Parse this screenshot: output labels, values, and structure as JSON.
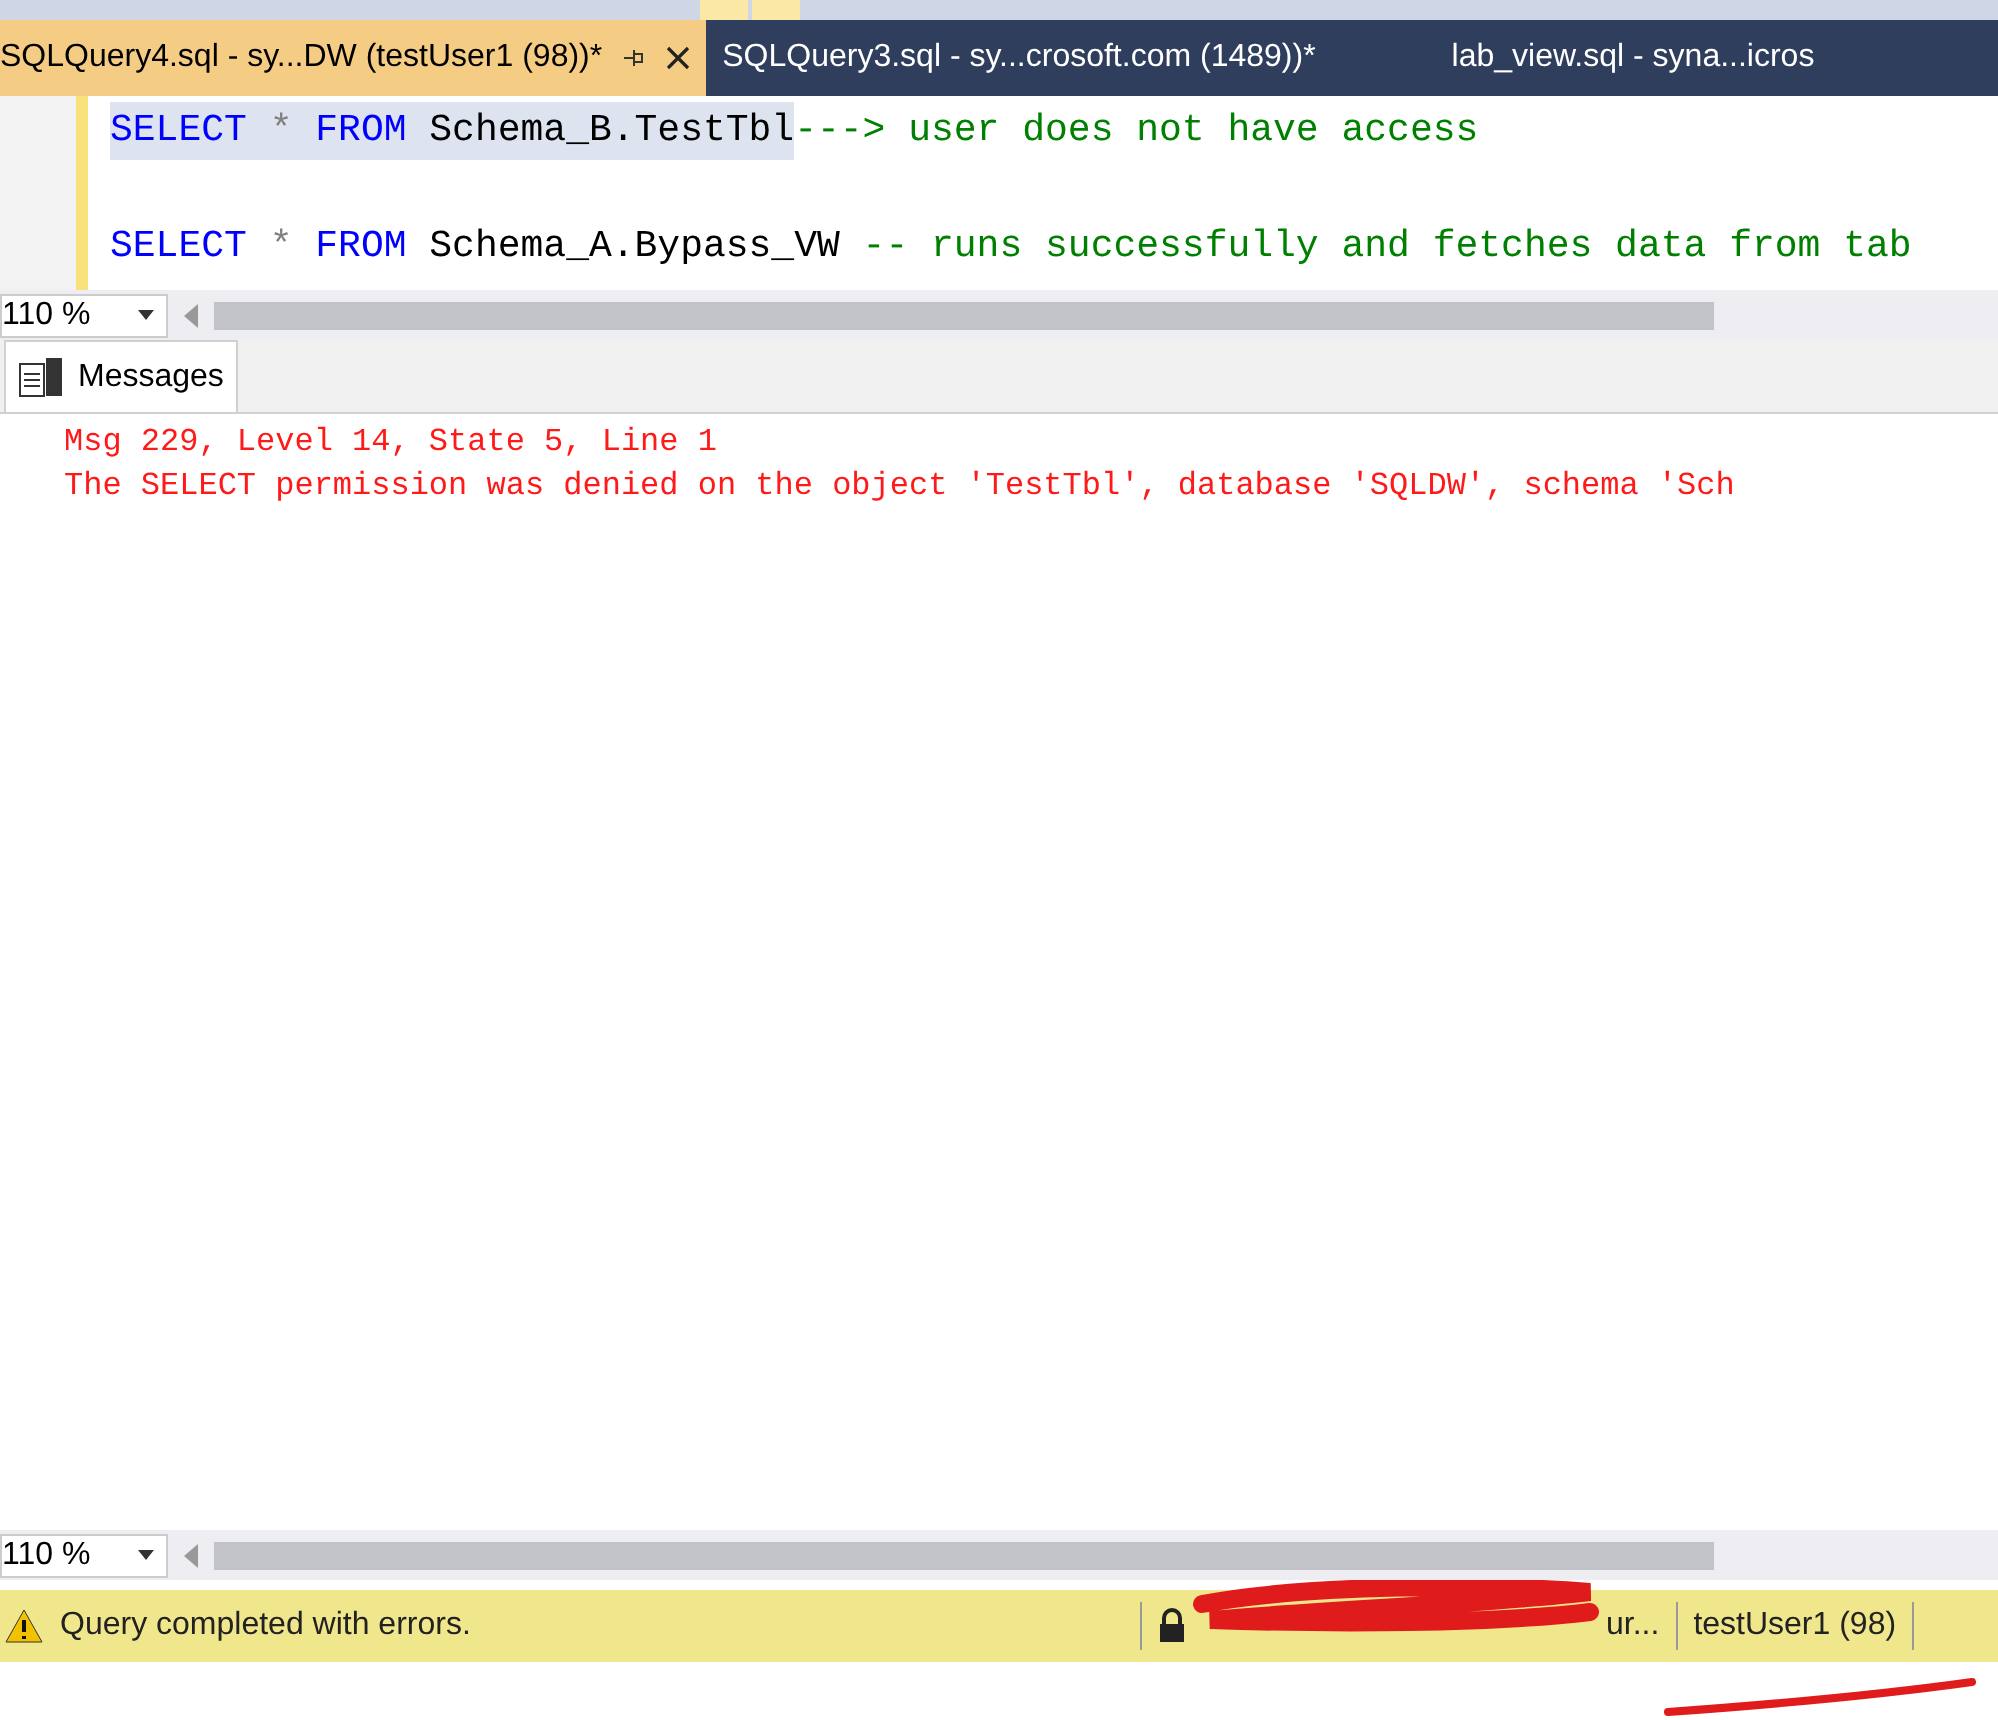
{
  "tabs": [
    {
      "label": "SQLQuery4.sql - sy...DW (testUser1 (98))*",
      "selected": true,
      "pinnable": true
    },
    {
      "label": "SQLQuery3.sql - sy...crosoft.com (1489))*",
      "selected": false,
      "pinnable": false
    },
    {
      "label": "lab_view.sql - syna...icros",
      "selected": false,
      "pinnable": false
    }
  ],
  "editor": {
    "lines": [
      [
        {
          "text": "SELECT",
          "kind": "keyword",
          "highlighted": true
        },
        {
          "text": " * ",
          "kind": "operator",
          "highlighted": true
        },
        {
          "text": "FROM",
          "kind": "keyword",
          "highlighted": true
        },
        {
          "text": " Schema_B.TestTbl",
          "kind": "plain",
          "highlighted": true
        },
        {
          "text": "---> user does not have access",
          "kind": "comment",
          "highlighted": false
        }
      ],
      [
        {
          "text": "SELECT",
          "kind": "keyword",
          "highlighted": false
        },
        {
          "text": " * ",
          "kind": "operator",
          "highlighted": false
        },
        {
          "text": "FROM",
          "kind": "keyword",
          "highlighted": false
        },
        {
          "text": " Schema_A.Bypass_VW ",
          "kind": "plain",
          "highlighted": false
        },
        {
          "text": "-- runs successfully and fetches data from tab",
          "kind": "comment",
          "highlighted": false
        }
      ]
    ],
    "zoom": "110 %"
  },
  "results": {
    "tab": "Messages",
    "messages": [
      "Msg 229, Level 14, State 5, Line 1",
      "The SELECT permission was denied on the object 'TestTbl', database 'SQLDW', schema 'Sch"
    ],
    "zoom": "110 %"
  },
  "status_bar": {
    "message": "Query completed with errors.",
    "server": "ur...",
    "user": "testUser1 (98)"
  }
}
